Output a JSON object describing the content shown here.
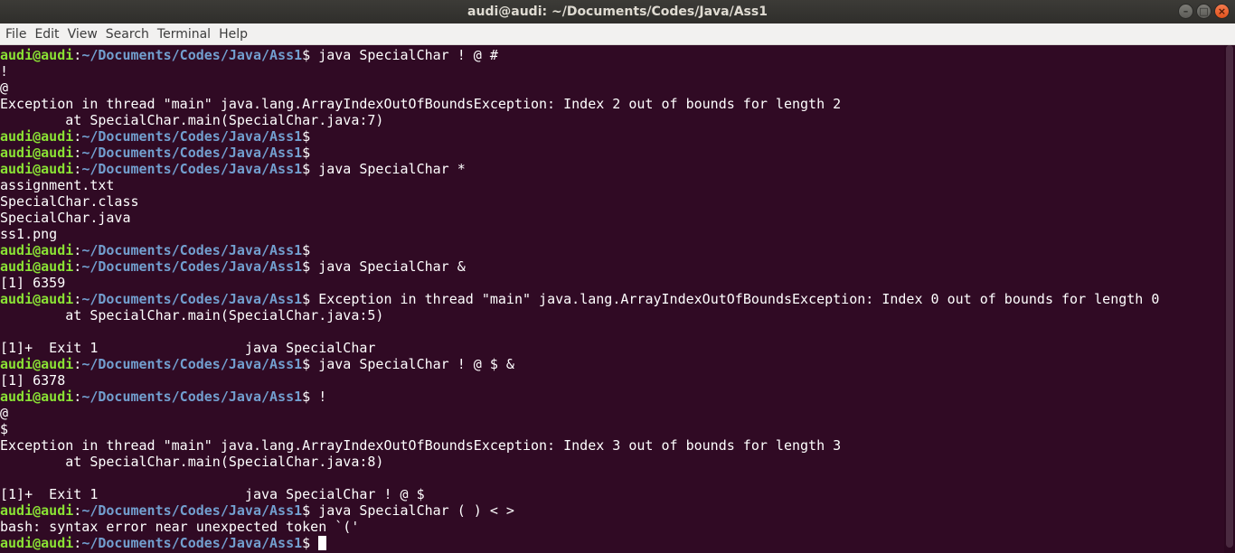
{
  "window": {
    "title": "audi@audi: ~/Documents/Codes/Java/Ass1",
    "controls": [
      "minimize-icon",
      "maximize-icon",
      "close-icon"
    ]
  },
  "menu": {
    "items": [
      "File",
      "Edit",
      "View",
      "Search",
      "Terminal",
      "Help"
    ]
  },
  "prompt": {
    "user": "audi@audi",
    "path": "~/Documents/Codes/Java/Ass1"
  },
  "terminal": {
    "lines": [
      {
        "type": "prompt",
        "cmd": " java SpecialChar ! @ #"
      },
      {
        "type": "output",
        "text": "!"
      },
      {
        "type": "output",
        "text": "@"
      },
      {
        "type": "output",
        "text": "Exception in thread \"main\" java.lang.ArrayIndexOutOfBoundsException: Index 2 out of bounds for length 2"
      },
      {
        "type": "output",
        "text": "        at SpecialChar.main(SpecialChar.java:7)"
      },
      {
        "type": "prompt",
        "cmd": ""
      },
      {
        "type": "prompt",
        "cmd": ""
      },
      {
        "type": "prompt",
        "cmd": " java SpecialChar *"
      },
      {
        "type": "output",
        "text": "assignment.txt"
      },
      {
        "type": "output",
        "text": "SpecialChar.class"
      },
      {
        "type": "output",
        "text": "SpecialChar.java"
      },
      {
        "type": "output",
        "text": "ss1.png"
      },
      {
        "type": "prompt",
        "cmd": ""
      },
      {
        "type": "prompt",
        "cmd": " java SpecialChar &"
      },
      {
        "type": "output",
        "text": "[1] 6359"
      },
      {
        "type": "prompt",
        "cmd": " Exception in thread \"main\" java.lang.ArrayIndexOutOfBoundsException: Index 0 out of bounds for length 0"
      },
      {
        "type": "output",
        "text": "        at SpecialChar.main(SpecialChar.java:5)"
      },
      {
        "type": "output",
        "text": ""
      },
      {
        "type": "output",
        "text": "[1]+  Exit 1                  java SpecialChar"
      },
      {
        "type": "prompt",
        "cmd": " java SpecialChar ! @ $ &"
      },
      {
        "type": "output",
        "text": "[1] 6378"
      },
      {
        "type": "prompt",
        "cmd": " !"
      },
      {
        "type": "output",
        "text": "@"
      },
      {
        "type": "output",
        "text": "$"
      },
      {
        "type": "output",
        "text": "Exception in thread \"main\" java.lang.ArrayIndexOutOfBoundsException: Index 3 out of bounds for length 3"
      },
      {
        "type": "output",
        "text": "        at SpecialChar.main(SpecialChar.java:8)"
      },
      {
        "type": "output",
        "text": ""
      },
      {
        "type": "output",
        "text": "[1]+  Exit 1                  java SpecialChar ! @ $"
      },
      {
        "type": "prompt",
        "cmd": " java SpecialChar ( ) < >"
      },
      {
        "type": "output",
        "text": "bash: syntax error near unexpected token `('"
      },
      {
        "type": "prompt",
        "cmd": " ",
        "cursor": true
      }
    ]
  },
  "colors": {
    "background": "#300a24",
    "user": "#8ae234",
    "path": "#729fcf",
    "text": "#ffffff"
  }
}
